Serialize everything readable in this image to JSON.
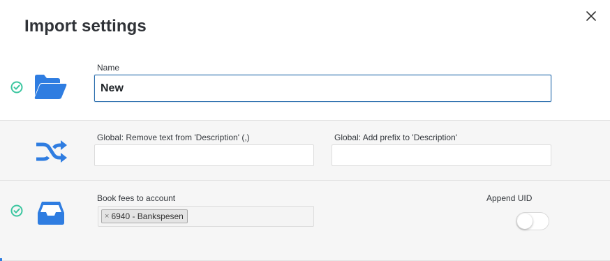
{
  "dialog": {
    "title": "Import settings",
    "close_icon": "close-icon"
  },
  "colors": {
    "accent": "#2f7de1",
    "check": "#3cc6a0",
    "focus_border": "#2c6fae"
  },
  "section_name": {
    "status_icon": "check-circle-icon",
    "icon": "folder-open-icon",
    "name_label": "Name",
    "name_value": "New"
  },
  "section_global": {
    "icon": "shuffle-icon",
    "remove_text_label": "Global: Remove text from 'Description' (,)",
    "remove_text_value": "",
    "add_prefix_label": "Global: Add prefix to 'Description'",
    "add_prefix_value": ""
  },
  "section_fees": {
    "status_icon": "check-circle-icon",
    "icon": "inbox-tray-icon",
    "fees_label": "Book fees to account",
    "fees_tags": [
      "6940 - Bankspesen"
    ],
    "append_uid_label": "Append UID",
    "append_uid_enabled": false
  }
}
